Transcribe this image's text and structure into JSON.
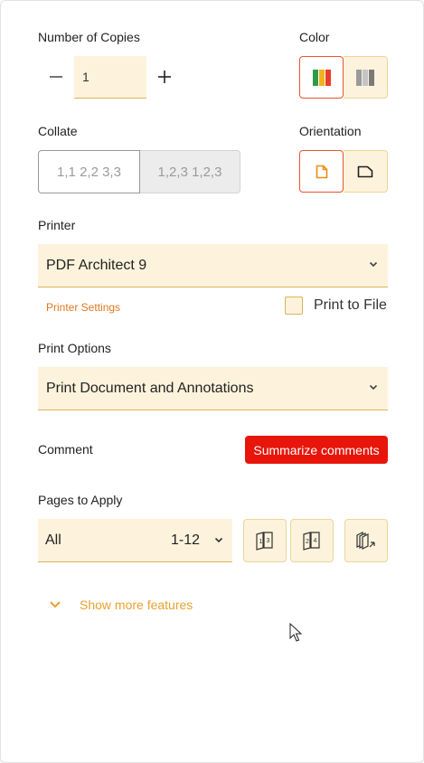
{
  "copies": {
    "label": "Number of Copies",
    "value": "1",
    "minus_icon": "minus-icon",
    "plus_icon": "plus-icon"
  },
  "color": {
    "label": "Color",
    "options": [
      "color-print-icon",
      "grayscale-print-icon"
    ],
    "selected": "color"
  },
  "collate": {
    "label": "Collate",
    "options": [
      "1,1 2,2 3,3",
      "1,2,3 1,2,3"
    ],
    "selected": "1,1 2,2 3,3"
  },
  "orientation": {
    "label": "Orientation",
    "options": [
      "portrait-icon",
      "landscape-icon"
    ],
    "selected": "portrait"
  },
  "printer": {
    "label": "Printer",
    "value": "PDF Architect 9",
    "settings_link": "Printer Settings",
    "print_to_file": "Print to File",
    "print_to_file_checked": false
  },
  "print_options": {
    "label": "Print Options",
    "value": "Print Document and Annotations"
  },
  "comment": {
    "label": "Comment",
    "button": "Summarize comments"
  },
  "pages": {
    "label": "Pages to Apply",
    "value": "All",
    "range": "1-12",
    "buttons": [
      "odd-pages-icon",
      "even-pages-icon",
      "reverse-pages-icon"
    ]
  },
  "show_more": "Show more features",
  "colors": {
    "accent": "#e8542e",
    "field_bg": "#fdf3dc",
    "red_button": "#e8150b",
    "link_orange": "#e0781e"
  }
}
